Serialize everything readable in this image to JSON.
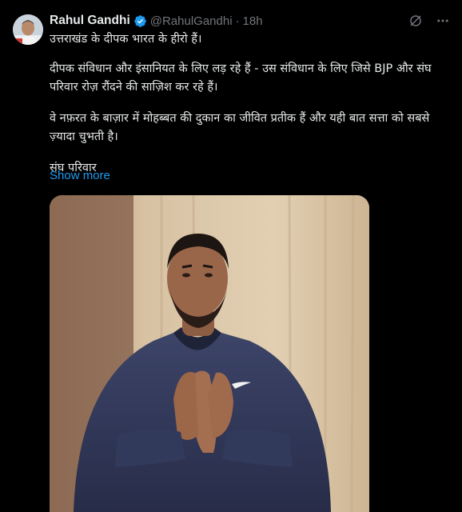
{
  "author": {
    "name": "Rahul Gandhi",
    "handle": "@RahulGandhi",
    "separator": "·",
    "time": "18h"
  },
  "icons": {
    "verified": "verified-badge-icon",
    "grok": "grok-icon",
    "more": "more-icon",
    "verified_color": "#1d9bf0"
  },
  "post": {
    "paragraphs": [
      "उत्तराखंड के दीपक भारत के हीरो हैं।",
      "दीपक संविधान और इंसानियत के लिए लड़ रहे हैं - उस संविधान के लिए जिसे BJP और संघ परिवार रोज़ रौंदने की साज़िश कर रहे हैं।",
      "वे नफ़रत के बाज़ार में मोहब्बत की दुकान का जीवित प्रतीक हैं और यही बात सत्ता को सबसे ज़्यादा चुभती है।",
      "संघ परिवार"
    ],
    "show_more": "Show more"
  },
  "colors": {
    "background": "#000000",
    "text": "#e7e9ea",
    "muted": "#71767b",
    "link": "#1d9bf0"
  }
}
